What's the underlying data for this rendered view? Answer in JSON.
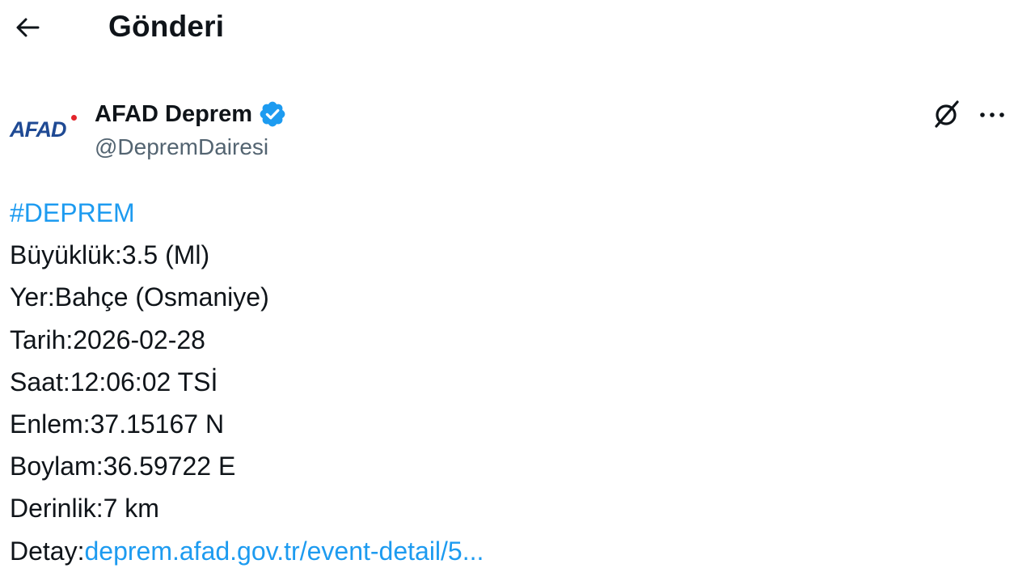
{
  "header": {
    "title": "Gönderi",
    "back_icon": "arrow-left-icon"
  },
  "author": {
    "avatar_text": "AFAD",
    "display_name": "AFAD Deprem",
    "handle": "@DepremDairesi",
    "verified_icon": "verified-badge-icon",
    "brand_color": "#1f4a94",
    "verified_color": "#1d9bf0"
  },
  "actions": {
    "grok_icon": "grok-icon",
    "more_icon": "more-options-icon"
  },
  "tweet": {
    "hashtag": "#DEPREM",
    "lines": [
      "Büyüklük:3.5 (Ml)",
      "Yer:Bahçe (Osmaniye)",
      "Tarih:2026-02-28",
      "Saat:12:06:02 TSİ",
      "Enlem:37.15167 N",
      "Boylam:36.59722 E",
      "Derinlik:7 km"
    ],
    "detail_label": "Detay:",
    "detail_link": "deprem.afad.gov.tr/event-detail/5...",
    "link_color": "#1d9bf0"
  }
}
